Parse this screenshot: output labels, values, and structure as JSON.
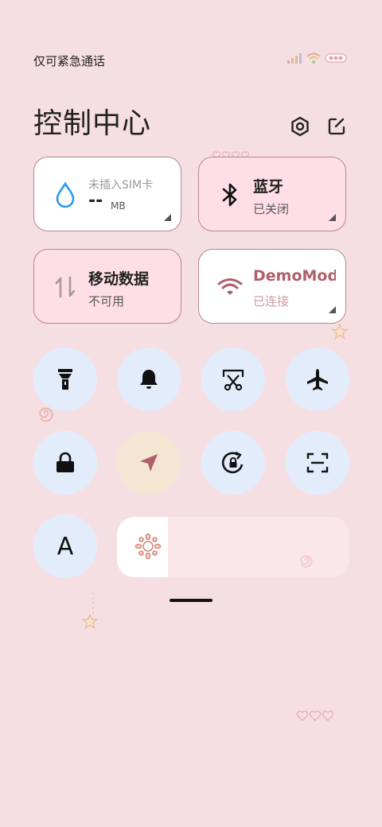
{
  "status_bar": {
    "carrier_text": "仅可紧急通话",
    "icons": [
      "signal-icon",
      "wifi-icon",
      "battery-icon"
    ]
  },
  "header": {
    "title": "控制中心",
    "settings_icon": "gear-icon",
    "edit_icon": "edit-icon"
  },
  "tiles": {
    "data_usage": {
      "label": "未插入SIM卡",
      "value": "--",
      "unit": "MB",
      "icon": "water-drop-icon"
    },
    "bluetooth": {
      "title": "蓝牙",
      "status": "已关闭",
      "icon": "bluetooth-icon"
    },
    "mobile_data": {
      "title": "移动数据",
      "status": "不可用",
      "icon": "data-arrows-icon"
    },
    "wifi": {
      "title": "DemoMod",
      "status": "已连接",
      "icon": "wifi-icon"
    }
  },
  "toggles": [
    {
      "name": "flashlight",
      "icon": "flashlight-icon"
    },
    {
      "name": "mute",
      "icon": "bell-icon"
    },
    {
      "name": "screenshot",
      "icon": "scissors-icon"
    },
    {
      "name": "airplane-mode",
      "icon": "airplane-icon"
    },
    {
      "name": "lock-screen",
      "icon": "lock-icon"
    },
    {
      "name": "location",
      "icon": "location-arrow-icon"
    },
    {
      "name": "rotation-lock",
      "icon": "rotation-lock-icon"
    },
    {
      "name": "scanner",
      "icon": "scan-icon"
    }
  ],
  "font_toggle": {
    "label": "A"
  },
  "brightness": {
    "level_percent": 22,
    "icon": "sun-icon"
  },
  "colors": {
    "background": "#f6dfe2",
    "tile_active_pink": "#ffdfe6",
    "tile_border": "#b8868e",
    "toggle_bg": "#e3ecfa",
    "location_bg": "#f5e6d3",
    "accent_wifi": "#b0606a",
    "drop_blue": "#2b9cef"
  }
}
